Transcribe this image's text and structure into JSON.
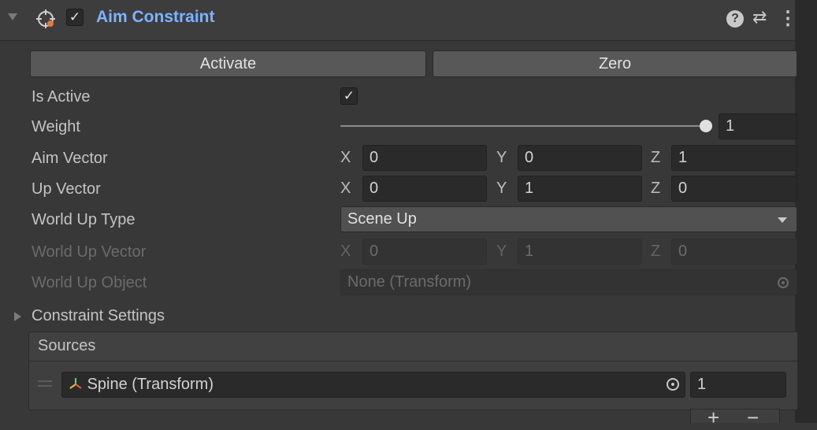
{
  "header": {
    "title": "Aim Constraint",
    "enabled_check": "✓",
    "help_icon": "?",
    "presets_icon": "⇄",
    "more_icon": "⋮"
  },
  "buttons": {
    "activate": "Activate",
    "zero": "Zero"
  },
  "properties": {
    "is_active": {
      "label": "Is Active",
      "check": "✓"
    },
    "weight": {
      "label": "Weight",
      "value": "1",
      "slider_fraction": 1.0
    },
    "aim_vector": {
      "label": "Aim Vector",
      "x": "0",
      "y": "0",
      "z": "1"
    },
    "up_vector": {
      "label": "Up Vector",
      "x": "0",
      "y": "1",
      "z": "0"
    },
    "world_up_type": {
      "label": "World Up Type",
      "value": "Scene Up"
    },
    "world_up_vector": {
      "label": "World Up Vector",
      "x": "0",
      "y": "1",
      "z": "0"
    },
    "world_up_object": {
      "label": "World Up Object",
      "value": "None (Transform)"
    }
  },
  "axes": {
    "x": "X",
    "y": "Y",
    "z": "Z"
  },
  "foldout": {
    "label": "Constraint Settings"
  },
  "sources": {
    "header": "Sources",
    "items": [
      {
        "name": "Spine (Transform)",
        "weight": "1"
      }
    ],
    "add": "+",
    "remove": "−"
  }
}
